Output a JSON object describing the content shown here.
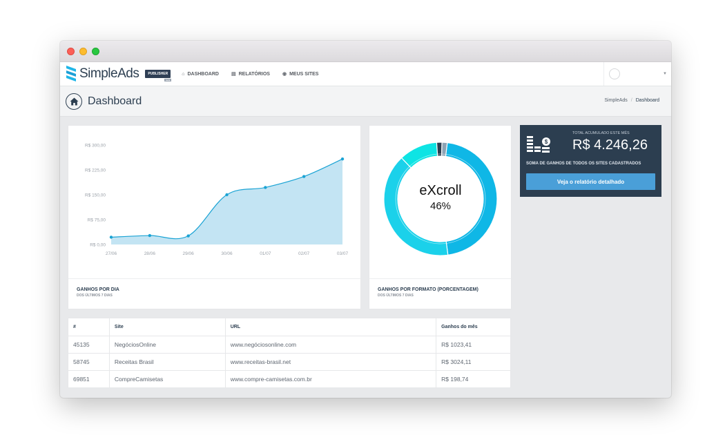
{
  "window": {
    "controls": [
      "close",
      "minimize",
      "maximize"
    ]
  },
  "nav": {
    "brand": "SimpleAds",
    "badge": "PUBLISHER",
    "badge_sub": "beta",
    "items": [
      {
        "icon": "home-icon",
        "label": "DASHBOARD"
      },
      {
        "icon": "file-icon",
        "label": "RELATÓRIOS"
      },
      {
        "icon": "globe-icon",
        "label": "MEUS SITES"
      }
    ]
  },
  "page": {
    "title": "Dashboard",
    "breadcrumb": [
      "SimpleAds",
      "Dashboard"
    ]
  },
  "line_card": {
    "title": "GANHOS POR DIA",
    "subtitle": "DOS ÚLTIMOS 7 DIAS"
  },
  "donut_card": {
    "title": "GANHOS POR FORMATO (PORCENTAGEM)",
    "subtitle": "DOS ÚLTIMOS 7 DIAS",
    "center_label": "eXcroll",
    "center_value": "46%"
  },
  "stats": {
    "label": "TOTAL ACUMULADO ESTE MÊS",
    "value": "R$ 4.246,26",
    "subtitle": "SOMA DE GANHOS DE TODOS OS SITES CADASTRADOS",
    "button": "Veja o relatório detalhado"
  },
  "table": {
    "headers": [
      "#",
      "Site",
      "URL",
      "Ganhos do mês"
    ],
    "rows": [
      [
        "45135",
        "NegóciosOnline",
        "www.negóciosonline.com",
        "R$ 1023,41"
      ],
      [
        "58745",
        "Receitas Brasil",
        "www.receitas-brasil.net",
        "R$ 3024,11"
      ],
      [
        "69851",
        "CompreCamisetas",
        "www.compre-camisetas.com.br",
        "R$ 198,74"
      ]
    ]
  },
  "colors": {
    "navy": "#2c3e50",
    "area_fill": "#c3e4f3",
    "line": "#1aa3d4",
    "donut_main": "#0fb7e6",
    "donut_teal": "#10e0e6",
    "button": "#4a9fd8"
  },
  "chart_data": [
    {
      "type": "area",
      "title": "",
      "x": [
        "27/06",
        "28/06",
        "29/06",
        "30/06",
        "01/07",
        "02/07",
        "03/07"
      ],
      "y_ticks": [
        "R$ 300,00",
        "R$ 225,00",
        "R$ 150,00",
        "R$ 75,00",
        "R$ 0,00"
      ],
      "ylim": [
        0,
        300
      ],
      "values": [
        22,
        27,
        26,
        150,
        172,
        205,
        258
      ],
      "grid": false
    },
    {
      "type": "pie",
      "title": "",
      "labels": [
        "eXcroll"
      ],
      "values": [
        46,
        40,
        11,
        1.5,
        1.5
      ],
      "colors": [
        "#0fb7e6",
        "#1bd1ea",
        "#0ee4e4",
        "#2c3e50",
        "#8ca3b4"
      ]
    }
  ]
}
